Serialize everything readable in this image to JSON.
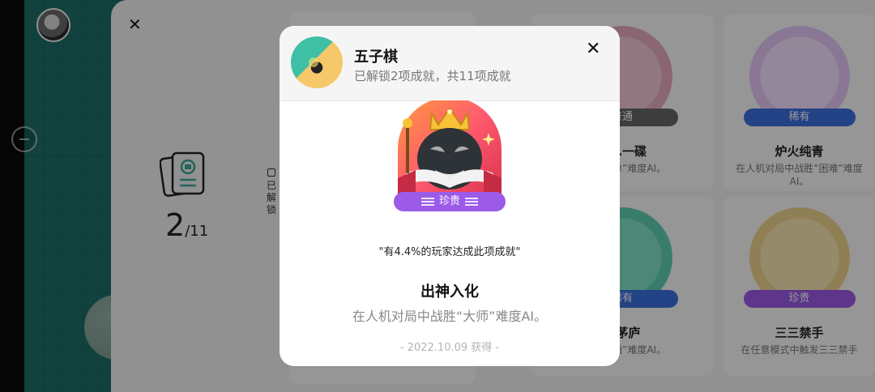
{
  "background": {
    "panel": {
      "progress_value": "2",
      "progress_total": "/11",
      "tab_label": "已解锁"
    },
    "cards": [
      {
        "rarity": "普通",
        "title": "一…一碟",
        "desc": "战胜“简单”难度AI。",
        "color": "#666666"
      },
      {
        "rarity": "稀有",
        "title": "炉火纯青",
        "desc": "在人机对局中战胜“困难”难度AI。",
        "color": "#3d6fe0"
      },
      {
        "rarity": "稀有",
        "title": "…茅庐",
        "desc": "战胜“普通”难度AI。",
        "color": "#3d6fe0"
      },
      {
        "rarity": "珍贵",
        "title": "三三禁手",
        "desc": "在任意模式中触发三三禁手",
        "color": "#9c5ae8"
      }
    ]
  },
  "modal": {
    "game_name": "五子棋",
    "subtitle": "已解锁2项成就，共11项成就",
    "rarity": "珍贵",
    "rarity_color": "#9c5ae8",
    "percent_text": "\"有4.4%的玩家达成此项成就\"",
    "achievement_title": "出神入化",
    "achievement_desc": "在人机对局中战胜“大师”难度AI。",
    "date_text": "- 2022.10.09 获得 -"
  },
  "icons": {
    "modal_close": "✕",
    "panel_close": "✕"
  }
}
